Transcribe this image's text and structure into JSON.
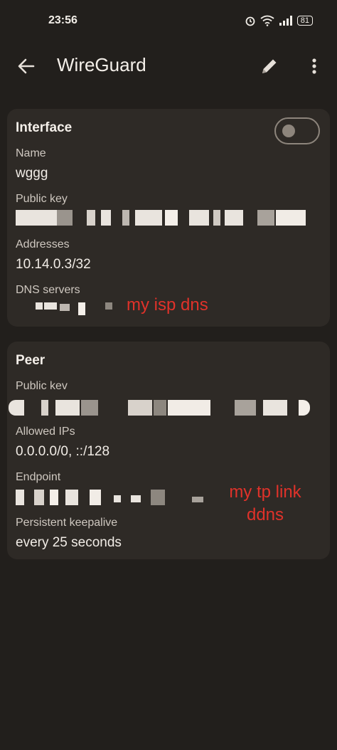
{
  "status_bar": {
    "time": "23:56",
    "battery": "81",
    "icons": [
      "alarm-icon",
      "wifi-icon",
      "signal-icon",
      "battery-icon"
    ]
  },
  "app_bar": {
    "title": "WireGuard",
    "icons": [
      "back-arrow-icon",
      "edit-pencil-icon",
      "more-vert-icon"
    ]
  },
  "interface": {
    "title": "Interface",
    "toggle_on": false,
    "name_label": "Name",
    "name_value": "wggg",
    "public_key_label": "Public key",
    "addresses_label": "Addresses",
    "addresses_value": "10.14.0.3/32",
    "dns_label": "DNS servers"
  },
  "peer": {
    "title": "Peer",
    "public_key_label": "Public kev",
    "allowed_ips_label": "Allowed IPs",
    "allowed_ips_value": "0.0.0.0/0, ::/128",
    "endpoint_label": "Endpoint",
    "keepalive_label": "Persistent keepalive",
    "keepalive_value": "every 25 seconds"
  },
  "annotations": {
    "dns_note": "my isp dns",
    "endpoint_note_line1": "my tp link",
    "endpoint_note_line2": "ddns",
    "color": "#e0322a"
  },
  "colors": {
    "background": "#221f1c",
    "card": "#2e2a26",
    "toggle": "#8d857c"
  }
}
